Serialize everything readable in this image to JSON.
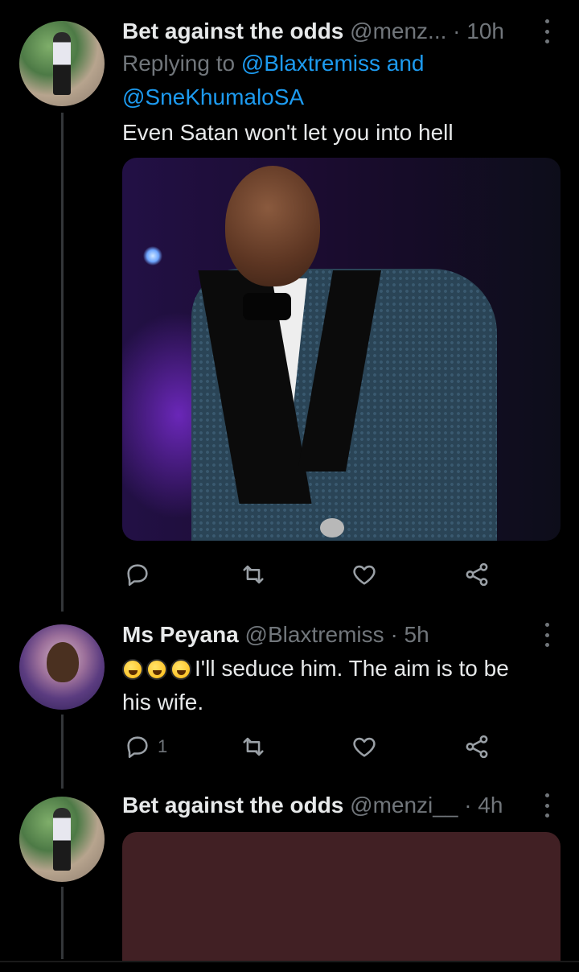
{
  "tweets": [
    {
      "name": "Bet against the odds",
      "handle": "@menz...",
      "time": "· 10h",
      "reply_prefix": "Replying to ",
      "reply_mention_1": "@Blaxtremiss",
      "reply_and": " and",
      "reply_mention_2": "@SneKhumaloSA",
      "text": "Even Satan won't let you into hell"
    },
    {
      "name": "Ms Peyana",
      "handle": "@Blaxtremiss",
      "time": "· 5h",
      "text_line_1": "I'll seduce him. The aim is to be",
      "text_line_2": "his wife.",
      "reply_count": "1"
    },
    {
      "name": "Bet against the odds",
      "handle": "@menzi__",
      "time": "· 4h"
    }
  ],
  "icons": [
    "reply-icon",
    "retweet-icon",
    "like-icon",
    "share-icon",
    "more-icon",
    "rofl-emoji"
  ],
  "colors": {
    "background": "#000000",
    "text": "#e7e9ea",
    "secondary": "#71767b",
    "mention": "#1d9bf0"
  }
}
